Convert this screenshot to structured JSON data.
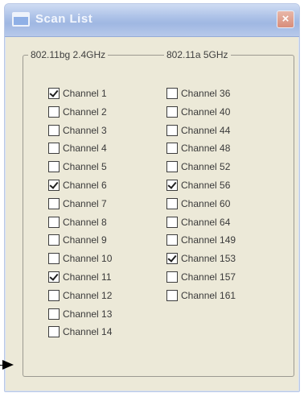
{
  "window": {
    "title": "Scan List",
    "close_label": "×",
    "icons": {
      "title": "window-icon",
      "close": "close-icon"
    },
    "colors": {
      "background": "#ece9d8",
      "titlebar": "#a9bfe6",
      "close": "#d88d7a"
    }
  },
  "bg_group": {
    "label": "802.11bg 2.4GHz",
    "channels": [
      {
        "label": "Channel 1",
        "checked": true
      },
      {
        "label": "Channel 2",
        "checked": false
      },
      {
        "label": "Channel 3",
        "checked": false
      },
      {
        "label": "Channel 4",
        "checked": false
      },
      {
        "label": "Channel 5",
        "checked": false
      },
      {
        "label": "Channel 6",
        "checked": true
      },
      {
        "label": "Channel 7",
        "checked": false
      },
      {
        "label": "Channel 8",
        "checked": false
      },
      {
        "label": "Channel 9",
        "checked": false
      },
      {
        "label": "Channel 10",
        "checked": false
      },
      {
        "label": "Channel 11",
        "checked": true
      },
      {
        "label": "Channel 12",
        "checked": false
      },
      {
        "label": "Channel 13",
        "checked": false
      },
      {
        "label": "Channel 14",
        "checked": false
      }
    ]
  },
  "a_group": {
    "label": "802.11a 5GHz",
    "channels": [
      {
        "label": "Channel 36",
        "checked": false
      },
      {
        "label": "Channel 40",
        "checked": false
      },
      {
        "label": "Channel 44",
        "checked": false
      },
      {
        "label": "Channel 48",
        "checked": false
      },
      {
        "label": "Channel 52",
        "checked": false
      },
      {
        "label": "Channel 56",
        "checked": true
      },
      {
        "label": "Channel 60",
        "checked": false
      },
      {
        "label": "Channel 64",
        "checked": false
      },
      {
        "label": "Channel 149",
        "checked": false
      },
      {
        "label": "Channel 153",
        "checked": true
      },
      {
        "label": "Channel 157",
        "checked": false
      },
      {
        "label": "Channel 161",
        "checked": false
      }
    ]
  },
  "pointer": {
    "icon": "arrow-pointer-icon"
  }
}
